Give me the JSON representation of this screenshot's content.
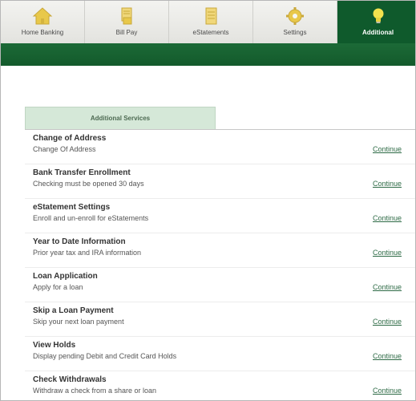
{
  "nav": {
    "tabs": [
      {
        "label": "Home Banking",
        "icon": "house-icon",
        "active": false
      },
      {
        "label": "Bill Pay",
        "icon": "bill-document-icon",
        "active": false
      },
      {
        "label": "eStatements",
        "icon": "statement-document-icon",
        "active": false
      },
      {
        "label": "Settings",
        "icon": "gear-icon",
        "active": false
      },
      {
        "label": "Additional",
        "icon": "lightbulb-icon",
        "active": true
      }
    ]
  },
  "services": {
    "tab_label": "Additional Services",
    "items": [
      {
        "title": "Change of Address",
        "description": "Change Of Address",
        "link": "Continue"
      },
      {
        "title": "Bank Transfer Enrollment",
        "description": "Checking must be opened 30 days",
        "link": "Continue"
      },
      {
        "title": "eStatement Settings",
        "description": "Enroll and un-enroll for eStatements",
        "link": "Continue"
      },
      {
        "title": "Year to Date Information",
        "description": "Prior year tax and IRA information",
        "link": "Continue"
      },
      {
        "title": "Loan Application",
        "description": "Apply for a loan",
        "link": "Continue"
      },
      {
        "title": "Skip a Loan Payment",
        "description": "Skip your next loan payment",
        "link": "Continue"
      },
      {
        "title": "View Holds",
        "description": "Display pending Debit and Credit Card Holds",
        "link": "Continue"
      },
      {
        "title": "Check Withdrawals",
        "description": "Withdraw a check from a share or loan",
        "link": "Continue"
      }
    ]
  },
  "colors": {
    "brand_green": "#135a2b",
    "active_tab": "#0f5a2c",
    "panel_tab_bg": "#d5e8d8",
    "link": "#2e6b46",
    "icon_yellow": "#e8c84a"
  }
}
